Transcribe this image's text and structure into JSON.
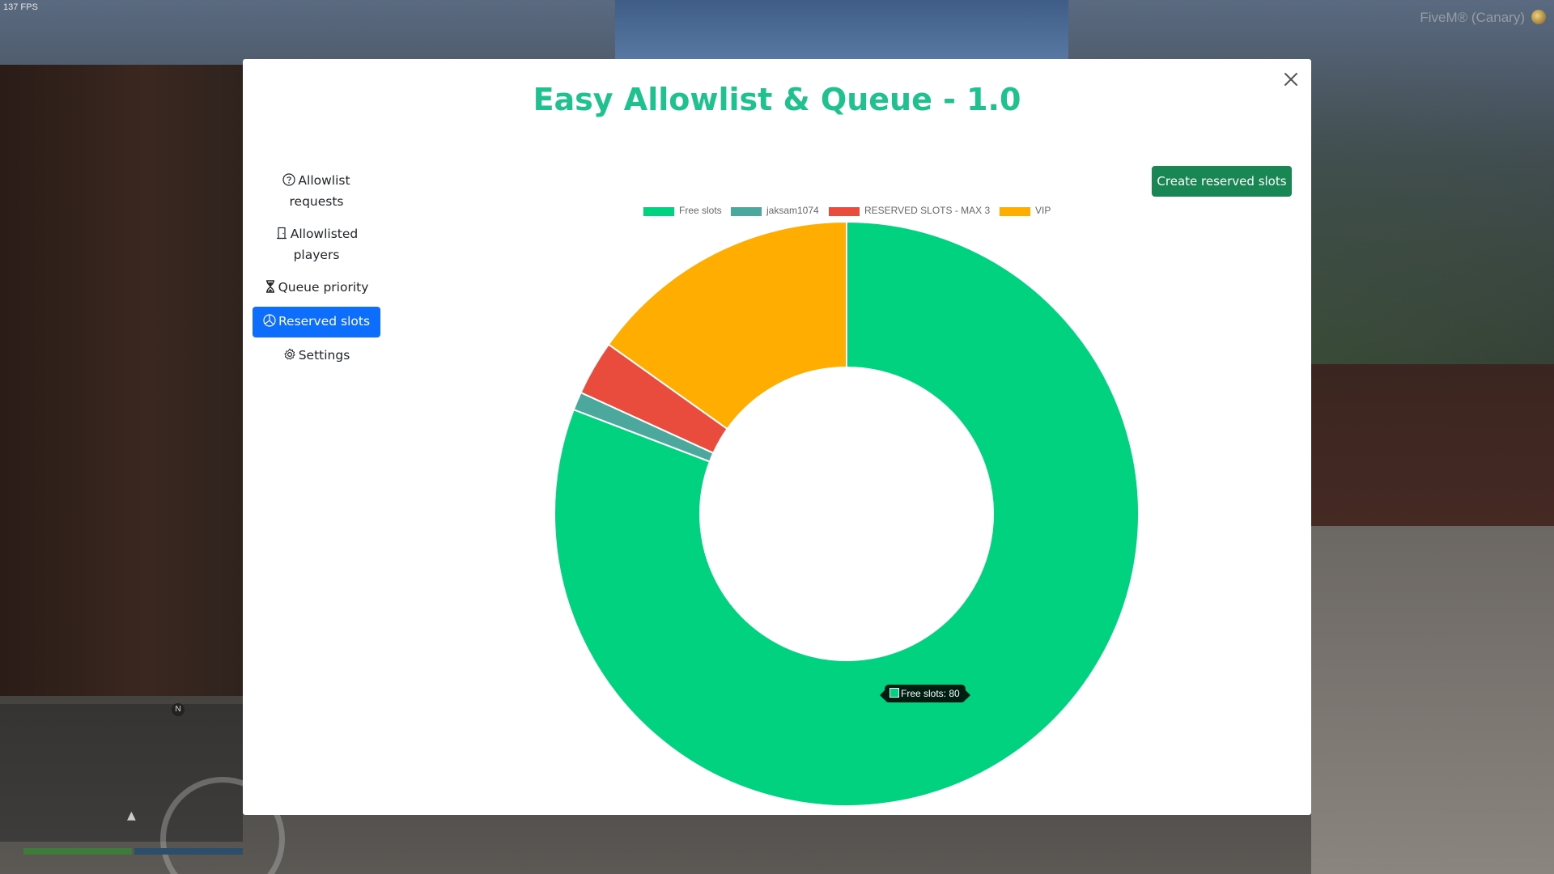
{
  "overlay": {
    "fps": "137 FPS",
    "brand": "FiveM® (Canary)",
    "minimap_north": "N"
  },
  "modal": {
    "title": "Easy Allowlist & Queue - 1.0",
    "close_icon": "close-icon"
  },
  "sidebar": {
    "items": [
      {
        "icon": "question-circle-icon",
        "label_line1": "Allowlist",
        "label_line2": "requests",
        "active": false
      },
      {
        "icon": "door-icon",
        "label_line1": "Allowlisted",
        "label_line2": "players",
        "active": false
      },
      {
        "icon": "hourglass-icon",
        "label_line1": "Queue priority",
        "label_line2": "",
        "active": false
      },
      {
        "icon": "pie-chart-icon",
        "label_line1": "Reserved slots",
        "label_line2": "",
        "active": true
      },
      {
        "icon": "gear-icon",
        "label_line1": "Settings",
        "label_line2": "",
        "active": false
      }
    ],
    "active_color": "#0d6efd"
  },
  "toolbar": {
    "create_label": "Create reserved slots",
    "create_color": "#198754"
  },
  "chart_data": {
    "type": "pie",
    "variant": "doughnut",
    "categories": [
      "Free slots",
      "jaksam1074",
      "RESERVED SLOTS - MAX 3",
      "VIP"
    ],
    "values": [
      80,
      1,
      3,
      15
    ],
    "colors": [
      "#00d27f",
      "#4ca89c",
      "#e94b3c",
      "#ffae00"
    ],
    "legend_position": "top",
    "tooltip": {
      "label": "Free slots: 80",
      "series": "Free slots"
    }
  }
}
